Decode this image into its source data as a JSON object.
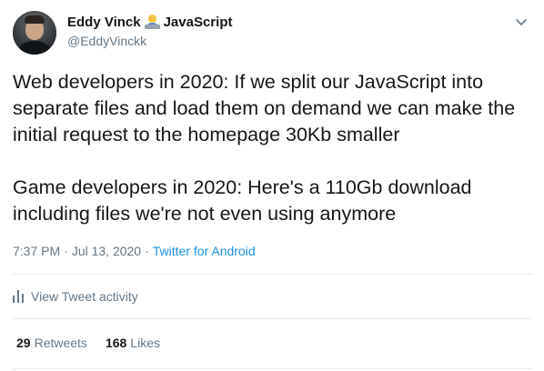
{
  "author": {
    "display_name": "Eddy Vinck",
    "name_suffix": "JavaScript",
    "emoji": "technologist-emoji",
    "handle": "@EddyVinckk"
  },
  "tweet": {
    "text": "Web developers in 2020: If we split our JavaScript into separate files and load them on demand we can make the initial request to the homepage 30Kb smaller\n\nGame developers in 2020: Here's a 110Gb download including files we're not even using anymore",
    "time": "7:37 PM",
    "date": "Jul 13, 2020",
    "separator": "·",
    "source": "Twitter for Android"
  },
  "activity": {
    "label": "View Tweet activity"
  },
  "stats": {
    "retweets_count": "29",
    "retweets_label": "Retweets",
    "likes_count": "168",
    "likes_label": "Likes"
  },
  "colors": {
    "text": "#14171a",
    "secondary": "#657786",
    "link": "#1b95e0",
    "divider": "#e6ecf0"
  }
}
